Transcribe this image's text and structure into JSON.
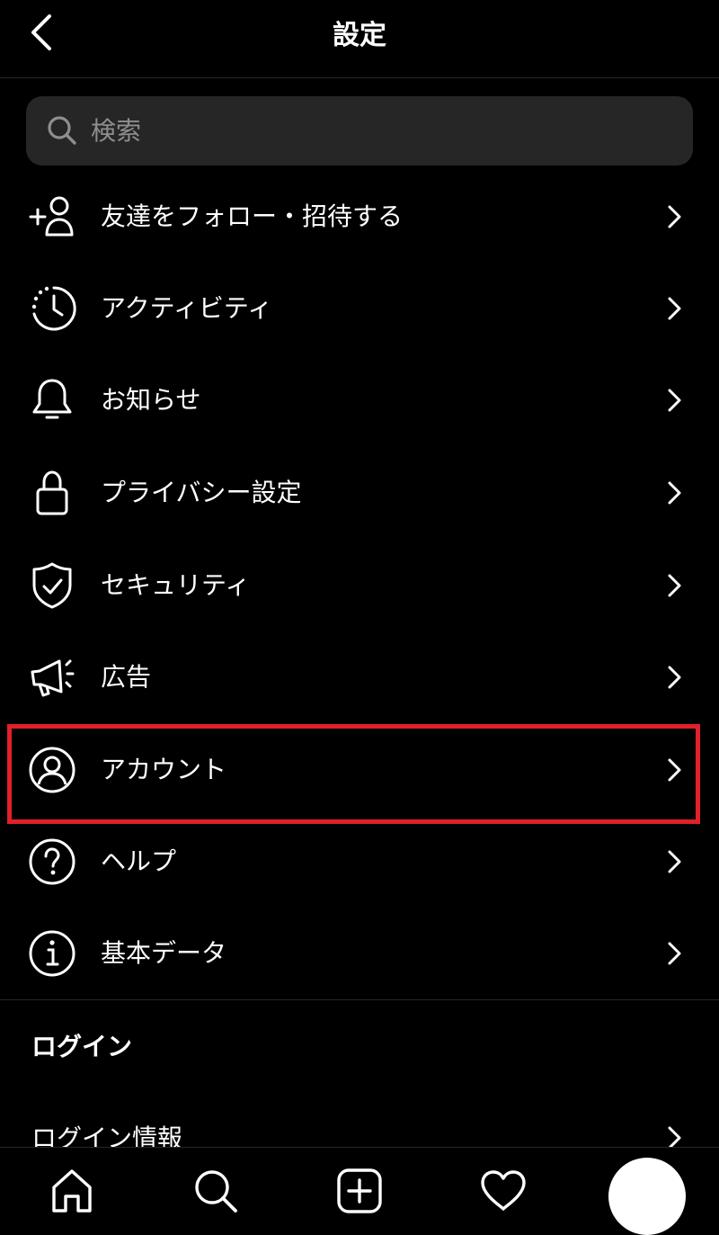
{
  "header": {
    "title": "設定",
    "back_icon": "chevron-left-icon"
  },
  "search": {
    "placeholder": "検索",
    "value": "",
    "icon": "search-icon"
  },
  "menu": [
    {
      "label": "友達をフォロー・招待する",
      "icon": "add-person-icon"
    },
    {
      "label": "アクティビティ",
      "icon": "activity-clock-icon"
    },
    {
      "label": "お知らせ",
      "icon": "bell-icon"
    },
    {
      "label": "プライバシー設定",
      "icon": "lock-icon"
    },
    {
      "label": "セキュリティ",
      "icon": "shield-check-icon"
    },
    {
      "label": "広告",
      "icon": "megaphone-icon"
    },
    {
      "label": "アカウント",
      "icon": "account-circle-icon",
      "highlighted": true
    },
    {
      "label": "ヘルプ",
      "icon": "help-circle-icon"
    },
    {
      "label": "基本データ",
      "icon": "info-circle-icon"
    }
  ],
  "login_section": {
    "title": "ログイン",
    "items": [
      {
        "label": "ログイン情報"
      }
    ]
  },
  "tabbar": {
    "tabs": [
      "home-icon",
      "search-icon",
      "add-square-icon",
      "heart-icon"
    ],
    "profile": "avatar"
  },
  "colors": {
    "background": "#000000",
    "text": "#ffffff",
    "search_bg": "#262626",
    "placeholder": "#8e8e8e",
    "highlight": "#e0202b",
    "divider": "#262626"
  }
}
